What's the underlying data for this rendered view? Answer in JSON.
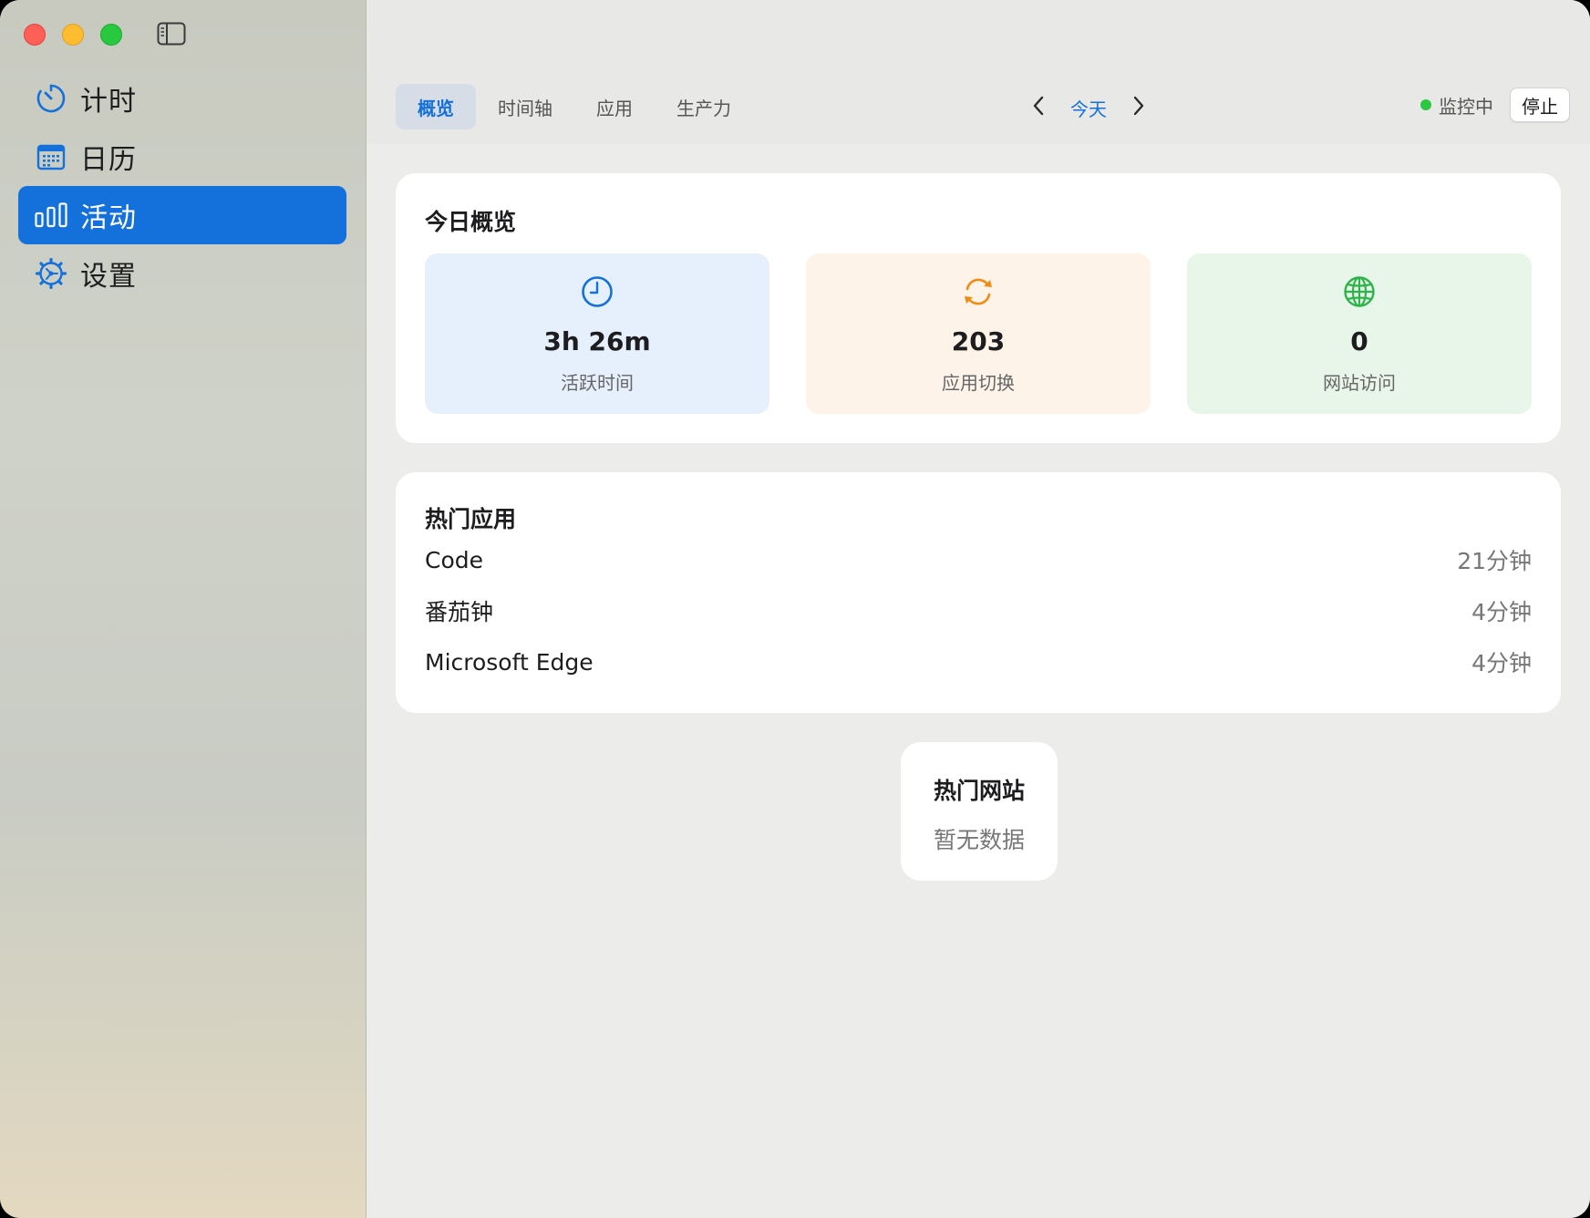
{
  "sidebar": {
    "items": [
      {
        "label": "计时",
        "icon": "timer-icon"
      },
      {
        "label": "日历",
        "icon": "calendar-icon"
      },
      {
        "label": "活动",
        "icon": "chart-bar-icon",
        "active": true
      },
      {
        "label": "设置",
        "icon": "gear-icon"
      }
    ]
  },
  "toolbar": {
    "tabs": [
      {
        "label": "概览",
        "active": true
      },
      {
        "label": "时间轴"
      },
      {
        "label": "应用"
      },
      {
        "label": "生产力"
      }
    ],
    "date_label": "今天",
    "status_text": "监控中",
    "stop_label": "停止"
  },
  "overview": {
    "title": "今日概览",
    "stats": [
      {
        "value": "3h 26m",
        "label": "活跃时间",
        "icon": "clock-icon",
        "color": "#1470da"
      },
      {
        "value": "203",
        "label": "应用切换",
        "icon": "refresh-icon",
        "color": "#f08c14"
      },
      {
        "value": "0",
        "label": "网站访问",
        "icon": "globe-icon",
        "color": "#2db34a"
      }
    ]
  },
  "top_apps": {
    "title": "热门应用",
    "rows": [
      {
        "name": "Code",
        "duration": "21分钟"
      },
      {
        "name": "番茄钟",
        "duration": "4分钟"
      },
      {
        "name": "Microsoft Edge",
        "duration": "4分钟"
      }
    ]
  },
  "top_sites": {
    "title": "热门网站",
    "empty_text": "暂无数据"
  },
  "colors": {
    "accent": "#1470da",
    "status_green": "#2bc840"
  }
}
